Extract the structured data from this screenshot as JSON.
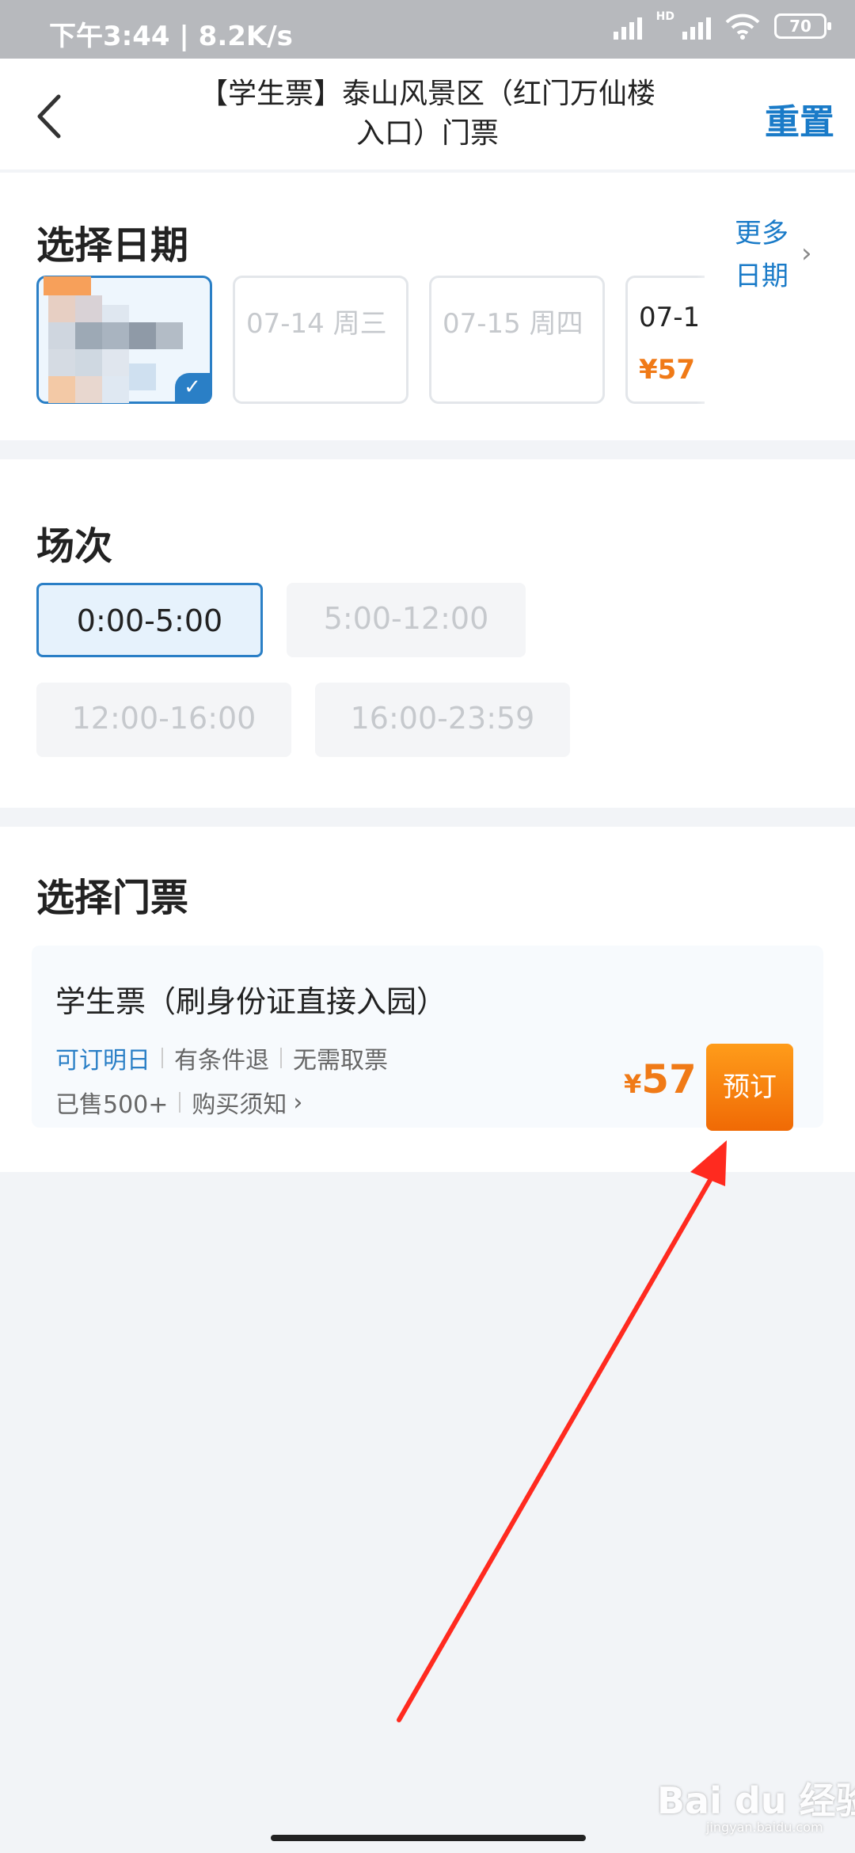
{
  "status_bar": {
    "left_text": "下午3:44 | 8.2K/s",
    "hd": "HD",
    "battery": "70"
  },
  "header": {
    "title": "【学生票】泰山风景区（红门万仙楼入口）门票",
    "reset": "重置"
  },
  "date_section": {
    "title": "选择日期",
    "dates": [
      {
        "label": "",
        "price": "",
        "selected": true
      },
      {
        "label": "07-14 周三",
        "price": "",
        "selected": false
      },
      {
        "label": "07-15 周四",
        "price": "",
        "selected": false
      },
      {
        "label": "07-1",
        "price": "¥57",
        "selected": false
      }
    ],
    "more_label": "更多日期"
  },
  "session_section": {
    "title": "场次",
    "sessions": [
      {
        "label": "0:00-5:00",
        "selected": true
      },
      {
        "label": "5:00-12:00",
        "selected": false
      },
      {
        "label": "12:00-16:00",
        "selected": false
      },
      {
        "label": "16:00-23:59",
        "selected": false
      }
    ]
  },
  "ticket_section": {
    "title": "选择门票",
    "ticket": {
      "name": "学生票（刷身份证直接入园）",
      "tags": [
        "可订明日",
        "有条件退",
        "无需取票"
      ],
      "sold": "已售500+",
      "notice": "购买须知",
      "price_symbol": "¥",
      "price": "57",
      "book_label": "预订"
    }
  },
  "watermark": {
    "text": "Bai du 经验",
    "sub": "jingyan.baidu.com"
  },
  "colors": {
    "accent_blue": "#2a7fc6",
    "orange": "#f07a17",
    "arrow_red": "#ff2a1f"
  }
}
